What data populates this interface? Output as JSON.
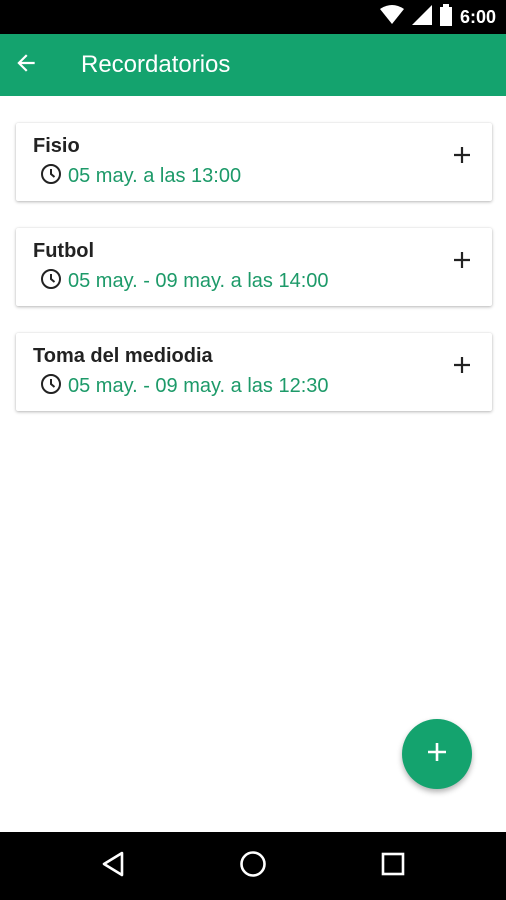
{
  "status_bar": {
    "time": "6:00",
    "icons": [
      "wifi-icon",
      "cell-signal-icon",
      "battery-icon"
    ]
  },
  "app_bar": {
    "title": "Recordatorios",
    "back_icon": "arrow-back-icon"
  },
  "reminders": [
    {
      "title": "Fisio",
      "schedule": "05 may. a las 13:00"
    },
    {
      "title": "Futbol",
      "schedule": "05 may. - 09 may. a las 14:00"
    },
    {
      "title": "Toma del mediodia",
      "schedule": "05 may. - 09 may. a las 12:30"
    }
  ],
  "fab": {
    "icon": "plus-icon"
  },
  "nav_bar": {
    "icons": [
      "back-triangle-icon",
      "home-circle-icon",
      "recents-square-icon"
    ]
  },
  "colors": {
    "primary": "#14a36e",
    "time_text": "#1d9a69"
  }
}
